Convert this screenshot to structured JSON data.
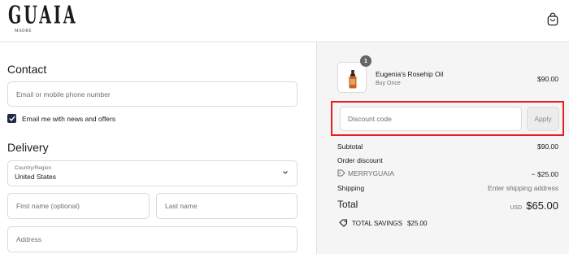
{
  "header": {
    "logo_text": "GUAIA",
    "logo_sub": "MADRE",
    "cart_icon": "shopping-bag-icon"
  },
  "contact": {
    "title": "Contact",
    "email_placeholder": "Email or mobile phone number",
    "newsletter_label": "Email me with news and offers",
    "newsletter_checked": true
  },
  "delivery": {
    "title": "Delivery",
    "country_label": "Country/Region",
    "country_value": "United States",
    "first_name_placeholder": "First name (optional)",
    "last_name_placeholder": "Last name",
    "address_placeholder": "Address"
  },
  "order": {
    "item": {
      "quantity": "1",
      "name": "Eugenia's Rosehip Oil",
      "subtitle": "Buy Once",
      "price": "$90.00"
    },
    "discount": {
      "placeholder": "Discount code",
      "apply_label": "Apply",
      "highlight_color": "#e41f22"
    },
    "subtotal_label": "Subtotal",
    "subtotal_value": "$90.00",
    "order_discount_label": "Order discount",
    "discount_code": "MERRYGUAIA",
    "discount_value": "− $25.00",
    "shipping_label": "Shipping",
    "shipping_value": "Enter shipping address",
    "total_label": "Total",
    "total_currency": "USD",
    "total_value": "$65.00",
    "savings_label": "TOTAL SAVINGS",
    "savings_value": "$25.00"
  }
}
